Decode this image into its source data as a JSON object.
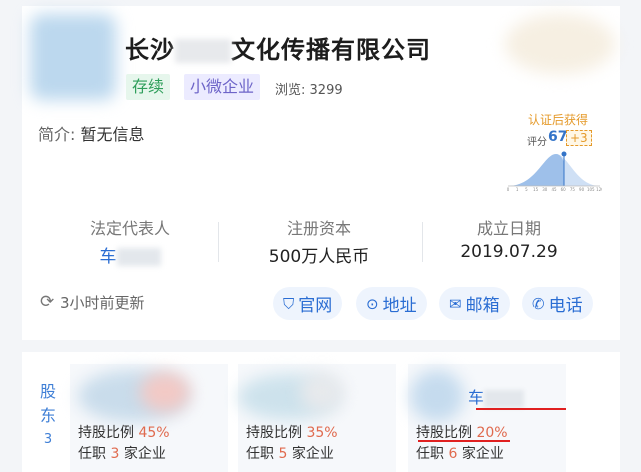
{
  "company": {
    "name_part1": "长沙",
    "name_part2": "文化传播有限公司",
    "tags": [
      "存续",
      "小微企业"
    ],
    "views_label": "浏览:",
    "views_count": "3299",
    "intro_label": "简介:",
    "intro_value": "暂无信息"
  },
  "score": {
    "badge_label": "认证后获得",
    "label": "评分",
    "value": "67",
    "bonus": "+3",
    "axis_ticks": [
      "0",
      "1",
      "5",
      "15",
      "30",
      "45",
      "60",
      "75",
      "90",
      "105",
      "120"
    ]
  },
  "info": [
    {
      "label": "法定代表人",
      "value": "车"
    },
    {
      "label": "注册资本",
      "value": "500万人民币"
    },
    {
      "label": "成立日期",
      "value": "2019.07.29"
    }
  ],
  "update_text": "3小时前更新",
  "actions": [
    {
      "icon": "shield-check-icon",
      "label": "官网"
    },
    {
      "icon": "location-pin-icon",
      "label": "地址"
    },
    {
      "icon": "mail-icon",
      "label": "邮箱"
    },
    {
      "icon": "phone-icon",
      "label": "电话"
    }
  ],
  "shareholders": {
    "label_line1": "股",
    "label_line2": "东",
    "count": "3",
    "items": [
      {
        "name": "",
        "ratio_label": "持股比例",
        "ratio": "45%",
        "job_prefix": "任职",
        "job_count": "3",
        "job_suffix": "家企业"
      },
      {
        "name": "",
        "ratio_label": "持股比例",
        "ratio": "35%",
        "job_prefix": "任职",
        "job_count": "5",
        "job_suffix": "家企业"
      },
      {
        "name": "车",
        "ratio_label": "持股比例",
        "ratio": "20%",
        "job_prefix": "任职",
        "job_count": "6",
        "job_suffix": "家企业"
      }
    ]
  },
  "colors": {
    "accent_blue": "#2a6dd3",
    "status_green": "#2f9e5b",
    "scale_purple": "#6d64c8",
    "ratio_red": "#e06a4e",
    "annotation_red": "#e02020"
  }
}
